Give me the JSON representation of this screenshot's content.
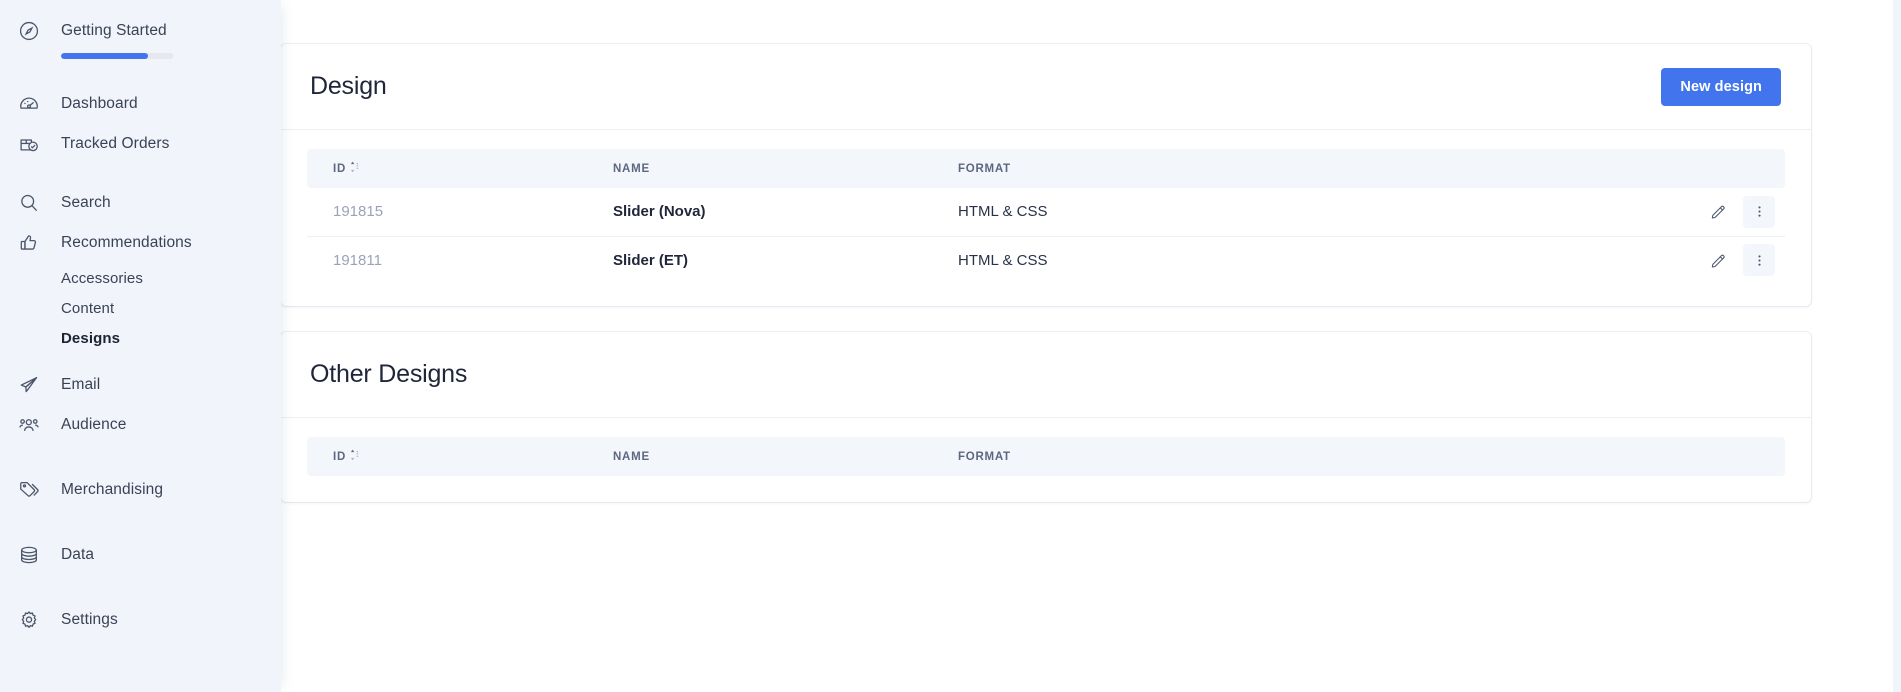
{
  "sidebar": {
    "getting_started": {
      "label": "Getting Started",
      "icon": "compass-icon",
      "progress_percent": 78
    },
    "items": [
      {
        "label": "Dashboard",
        "icon": "gauge-icon"
      },
      {
        "label": "Tracked Orders",
        "icon": "box-check-icon"
      },
      {
        "label": "Search",
        "icon": "magnifier-icon"
      },
      {
        "label": "Recommendations",
        "icon": "thumbs-up-icon"
      },
      {
        "label": "Email",
        "icon": "paper-plane-icon"
      },
      {
        "label": "Audience",
        "icon": "people-icon"
      },
      {
        "label": "Merchandising",
        "icon": "tag-icon"
      },
      {
        "label": "Data",
        "icon": "database-icon"
      },
      {
        "label": "Settings",
        "icon": "gear-icon"
      }
    ],
    "sub_items": [
      {
        "label": "Accessories",
        "active": false
      },
      {
        "label": "Content",
        "active": false
      },
      {
        "label": "Designs",
        "active": true
      }
    ]
  },
  "design_card": {
    "title": "Design",
    "new_button_label": "New design",
    "columns": {
      "id": "ID",
      "name": "NAME",
      "format": "FORMAT"
    },
    "rows": [
      {
        "id": "191815",
        "name": "Slider (Nova)",
        "format": "HTML & CSS"
      },
      {
        "id": "191811",
        "name": "Slider (ET)",
        "format": "HTML & CSS"
      }
    ],
    "row_actions": {
      "edit": "edit-pencil",
      "more": "more-vertical"
    }
  },
  "other_designs_card": {
    "title": "Other Designs",
    "columns": {
      "id": "ID",
      "name": "NAME",
      "format": "FORMAT"
    },
    "rows": []
  },
  "colors": {
    "accent": "#4274ee",
    "sidebar_bg": "#f1f4fa",
    "table_header_bg": "#f3f6fb",
    "text_primary": "#1f2639",
    "text_muted": "#9aa3b8"
  }
}
